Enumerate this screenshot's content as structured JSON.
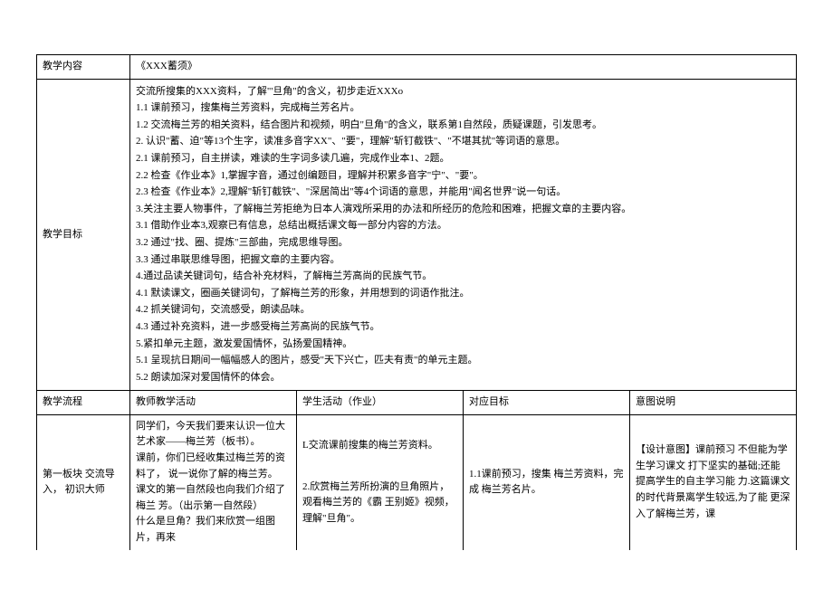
{
  "row1": {
    "label": "教学内容",
    "value": "《XXX蓄须》"
  },
  "row2": {
    "label": "教学目标",
    "lines": {
      "l0": "交流所搜集的XXX资料，了解\"'旦角\"的含义，初步走近XXXo",
      "l1": "1.1 课前预习，搜集梅兰芳资料，完成梅兰芳名片。",
      "l2": "1.2 交流梅兰芳的相关资料，结合图片和视频，明白\"旦角\"的含义，联系第1自然段，质疑课题，引发思考。",
      "l3": "2. 认识\"蓄、迫\"等13个生字，读准多音字XX\"、\"要\"，理解\"斩钉截铁\"、\"不堪其扰\"等词语的意思。",
      "l4": "2.1 课前预习，自主拼读，难读的生字词多读几遍，完成作业本1、2题。",
      "l5": "2.2 检查《作业本》1,掌握字音，通过创编题目，理解并积累多音字\"宁\"、\"要\"。",
      "l6": "2.3 检查《作业本》2,理解\"斩钉截铁\"、\"深居简出\"等4个词语的意思，并能用\"闻名世界\"说一句话。",
      "l7": "3.关注主要人物事件，了解梅兰芳拒绝为日本人演戏所采用的办法和所经历的危险和困难，把握文章的主要内容。",
      "l8": "3.1 借助作业本3,观察已有信息，总结出概括课文每一部分内容的方法。",
      "l9": "3.2 通过\"找、圈、提炼\"三部曲，完成思维导图。",
      "l10": "3.3 通过串联思维导图，把握文章的主要内容。",
      "l11": "4.通过品读关键词句，结合补充材料，了解梅兰芳高尚的民族气节。",
      "l12": "4.1 默读课文，圈画关键词句，了解梅兰芳的形象，并用想到的词语作批注。",
      "l13": "4.2 抓关键词句，交流感受，朗读品味。",
      "l14": "4.3 通过补充资料，进一步感受梅兰芳高尚的民族气节。",
      "l15": "5.紧扣单元主题，激发爱国情怀，弘扬爱国精神。",
      "l16": "5.1 呈现抗日期间一幅幅感人的图片，感受\"天下兴亡，匹夫有责\"的单元主题。",
      "l17": "5.2 朗读加深对爱国情怀的体会。"
    }
  },
  "row3": {
    "c0": "教学流程",
    "c1": "教师教学活动",
    "c2": "学生活动（作业）",
    "c3": "对应目标",
    "c4": "意图说明"
  },
  "row4": {
    "c0": "第一板块  交流导入，  初识大师",
    "c1": {
      "p1": "同学们，今天我们要来认识一位大艺术家——梅兰芳（板书）。",
      "p2": "课前，你们已经收集过梅兰芳的资料了，  说一说你了解的梅兰芳。",
      "p3": "课文的第一自然段也向我们介绍了梅兰  芳。（出示第一自然段）",
      "p4": "什么是旦角？我们来欣赏一组图片，再来"
    },
    "c2": {
      "p1": "L交流课前搜集的梅兰芳资料。",
      "p2": "2.欣赏梅兰芳所扮演的旦角照片，  观看梅兰芳的《霸  王别姬》视频，理解\"旦角\"。"
    },
    "c3": "1.1课前预习，搜集  梅兰芳资料，完成  梅兰芳名片。",
    "c4": "【设计意图】课前预习  不但能为学生学习课文  打下坚实的基础;还能  提高学生的自主学习能  力.这篇课文的时代背景离学生较远,为了能  更深入了解梅兰芳，课"
  }
}
